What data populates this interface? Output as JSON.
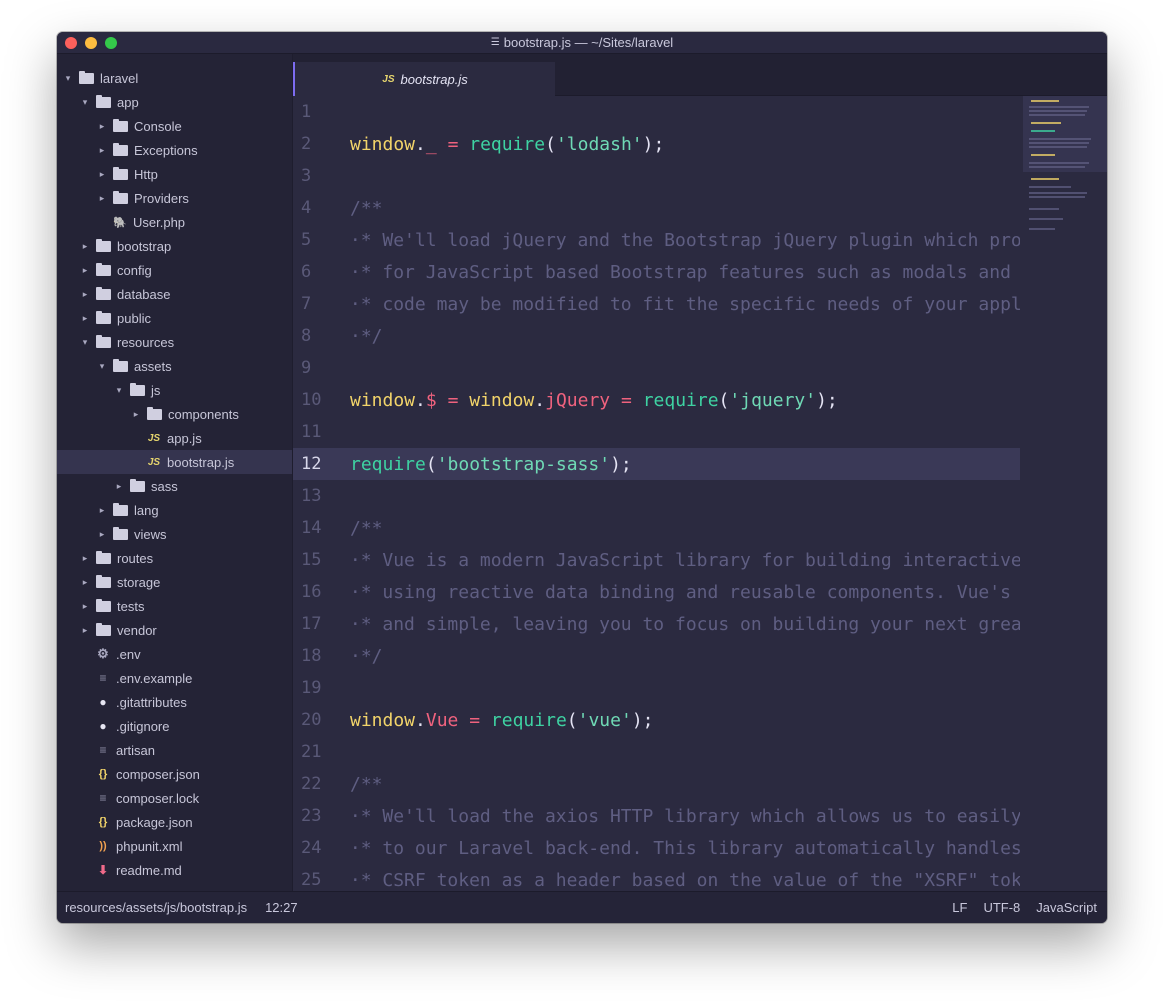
{
  "window": {
    "title": "bootstrap.js — ~/Sites/laravel"
  },
  "tree": [
    {
      "label": "laravel",
      "type": "folder",
      "depth": 0,
      "expanded": true
    },
    {
      "label": "app",
      "type": "folder",
      "depth": 1,
      "expanded": true
    },
    {
      "label": "Console",
      "type": "folder",
      "depth": 2,
      "expanded": false
    },
    {
      "label": "Exceptions",
      "type": "folder",
      "depth": 2,
      "expanded": false
    },
    {
      "label": "Http",
      "type": "folder",
      "depth": 2,
      "expanded": false
    },
    {
      "label": "Providers",
      "type": "folder",
      "depth": 2,
      "expanded": false
    },
    {
      "label": "User.php",
      "type": "file",
      "icon": "php-icon",
      "depth": 2
    },
    {
      "label": "bootstrap",
      "type": "folder",
      "depth": 1,
      "expanded": false
    },
    {
      "label": "config",
      "type": "folder",
      "depth": 1,
      "expanded": false
    },
    {
      "label": "database",
      "type": "folder",
      "depth": 1,
      "expanded": false
    },
    {
      "label": "public",
      "type": "folder",
      "depth": 1,
      "expanded": false
    },
    {
      "label": "resources",
      "type": "folder",
      "depth": 1,
      "expanded": true
    },
    {
      "label": "assets",
      "type": "folder",
      "depth": 2,
      "expanded": true
    },
    {
      "label": "js",
      "type": "folder",
      "depth": 3,
      "expanded": true
    },
    {
      "label": "components",
      "type": "folder",
      "depth": 4,
      "expanded": false
    },
    {
      "label": "app.js",
      "type": "file",
      "icon": "js-icon",
      "depth": 4
    },
    {
      "label": "bootstrap.js",
      "type": "file",
      "icon": "js-icon",
      "depth": 4,
      "selected": true
    },
    {
      "label": "sass",
      "type": "folder",
      "depth": 3,
      "expanded": false
    },
    {
      "label": "lang",
      "type": "folder",
      "depth": 2,
      "expanded": false
    },
    {
      "label": "views",
      "type": "folder",
      "depth": 2,
      "expanded": false
    },
    {
      "label": "routes",
      "type": "folder",
      "depth": 1,
      "expanded": false
    },
    {
      "label": "storage",
      "type": "folder",
      "depth": 1,
      "expanded": false
    },
    {
      "label": "tests",
      "type": "folder",
      "depth": 1,
      "expanded": false
    },
    {
      "label": "vendor",
      "type": "folder",
      "depth": 1,
      "expanded": false
    },
    {
      "label": ".env",
      "type": "file",
      "icon": "gear-icon",
      "depth": 1
    },
    {
      "label": ".env.example",
      "type": "file",
      "icon": "text-file-icon",
      "depth": 1
    },
    {
      "label": ".gitattributes",
      "type": "file",
      "icon": "github-icon",
      "depth": 1
    },
    {
      "label": ".gitignore",
      "type": "file",
      "icon": "github-icon",
      "depth": 1
    },
    {
      "label": "artisan",
      "type": "file",
      "icon": "text-file-icon",
      "depth": 1
    },
    {
      "label": "composer.json",
      "type": "file",
      "icon": "json-icon",
      "depth": 1
    },
    {
      "label": "composer.lock",
      "type": "file",
      "icon": "text-file-icon",
      "depth": 1
    },
    {
      "label": "package.json",
      "type": "file",
      "icon": "json-icon",
      "depth": 1
    },
    {
      "label": "phpunit.xml",
      "type": "file",
      "icon": "rss-icon",
      "depth": 1
    },
    {
      "label": "readme.md",
      "type": "file",
      "icon": "markdown-icon",
      "depth": 1
    }
  ],
  "tab": {
    "badge": "JS",
    "label": "bootstrap.js"
  },
  "editor": {
    "current_line": 12,
    "lines": [
      {
        "n": "1",
        "tokens": []
      },
      {
        "n": "2",
        "tokens": [
          [
            "ident",
            "window"
          ],
          [
            "punc",
            "."
          ],
          [
            "prop",
            "_"
          ],
          [
            "punc",
            " "
          ],
          [
            "op",
            "="
          ],
          [
            "punc",
            " "
          ],
          [
            "fn",
            "require"
          ],
          [
            "punc",
            "("
          ],
          [
            "str",
            "'lodash'"
          ],
          [
            "punc",
            ");"
          ]
        ]
      },
      {
        "n": "3",
        "tokens": []
      },
      {
        "n": "4",
        "tokens": [
          [
            "comment",
            "/**"
          ]
        ]
      },
      {
        "n": "5",
        "tokens": [
          [
            "comment",
            "·* We'll load jQuery and the Bootstrap jQuery plugin which pro"
          ]
        ]
      },
      {
        "n": "6",
        "tokens": [
          [
            "comment",
            "·* for JavaScript based Bootstrap features such as modals and "
          ]
        ]
      },
      {
        "n": "7",
        "tokens": [
          [
            "comment",
            "·* code may be modified to fit the specific needs of your appl"
          ]
        ]
      },
      {
        "n": "8",
        "tokens": [
          [
            "comment",
            "·*/"
          ]
        ]
      },
      {
        "n": "9",
        "tokens": []
      },
      {
        "n": "10",
        "tokens": [
          [
            "ident",
            "window"
          ],
          [
            "punc",
            "."
          ],
          [
            "prop",
            "$"
          ],
          [
            "punc",
            " "
          ],
          [
            "op",
            "="
          ],
          [
            "punc",
            " "
          ],
          [
            "ident",
            "window"
          ],
          [
            "punc",
            "."
          ],
          [
            "prop",
            "jQuery"
          ],
          [
            "punc",
            " "
          ],
          [
            "op",
            "="
          ],
          [
            "punc",
            " "
          ],
          [
            "fn",
            "require"
          ],
          [
            "punc",
            "("
          ],
          [
            "str",
            "'jquery'"
          ],
          [
            "punc",
            ");"
          ]
        ]
      },
      {
        "n": "11",
        "tokens": []
      },
      {
        "n": "12",
        "tokens": [
          [
            "fn",
            "require"
          ],
          [
            "punc",
            "("
          ],
          [
            "str",
            "'bootstrap-sass'"
          ],
          [
            "punc",
            ");"
          ]
        ]
      },
      {
        "n": "13",
        "tokens": []
      },
      {
        "n": "14",
        "tokens": [
          [
            "comment",
            "/**"
          ]
        ]
      },
      {
        "n": "15",
        "tokens": [
          [
            "comment",
            "·* Vue is a modern JavaScript library for building interactive"
          ]
        ]
      },
      {
        "n": "16",
        "tokens": [
          [
            "comment",
            "·* using reactive data binding and reusable components. Vue's "
          ]
        ]
      },
      {
        "n": "17",
        "tokens": [
          [
            "comment",
            "·* and simple, leaving you to focus on building your next grea"
          ]
        ]
      },
      {
        "n": "18",
        "tokens": [
          [
            "comment",
            "·*/"
          ]
        ]
      },
      {
        "n": "19",
        "tokens": []
      },
      {
        "n": "20",
        "tokens": [
          [
            "ident",
            "window"
          ],
          [
            "punc",
            "."
          ],
          [
            "prop",
            "Vue"
          ],
          [
            "punc",
            " "
          ],
          [
            "op",
            "="
          ],
          [
            "punc",
            " "
          ],
          [
            "fn",
            "require"
          ],
          [
            "punc",
            "("
          ],
          [
            "str",
            "'vue'"
          ],
          [
            "punc",
            ");"
          ]
        ]
      },
      {
        "n": "21",
        "tokens": []
      },
      {
        "n": "22",
        "tokens": [
          [
            "comment",
            "/**"
          ]
        ]
      },
      {
        "n": "23",
        "tokens": [
          [
            "comment",
            "·* We'll load the axios HTTP library which allows us to easily"
          ]
        ]
      },
      {
        "n": "24",
        "tokens": [
          [
            "comment",
            "·* to our Laravel back-end. This library automatically handles"
          ]
        ]
      },
      {
        "n": "25",
        "tokens": [
          [
            "comment",
            "·* CSRF token as a header based on the value of the \"XSRF\" tok"
          ]
        ]
      }
    ]
  },
  "status": {
    "path": "resources/assets/js/bootstrap.js",
    "cursor": "12:27",
    "line_ending": "LF",
    "encoding": "UTF-8",
    "grammar": "JavaScript"
  },
  "colors": {
    "accent": "#7d6cf0",
    "identifier": "#f2d46a",
    "property": "#f0627e",
    "function": "#3ed2a2",
    "string": "#6fd9b5",
    "comment": "#5f5e82"
  }
}
